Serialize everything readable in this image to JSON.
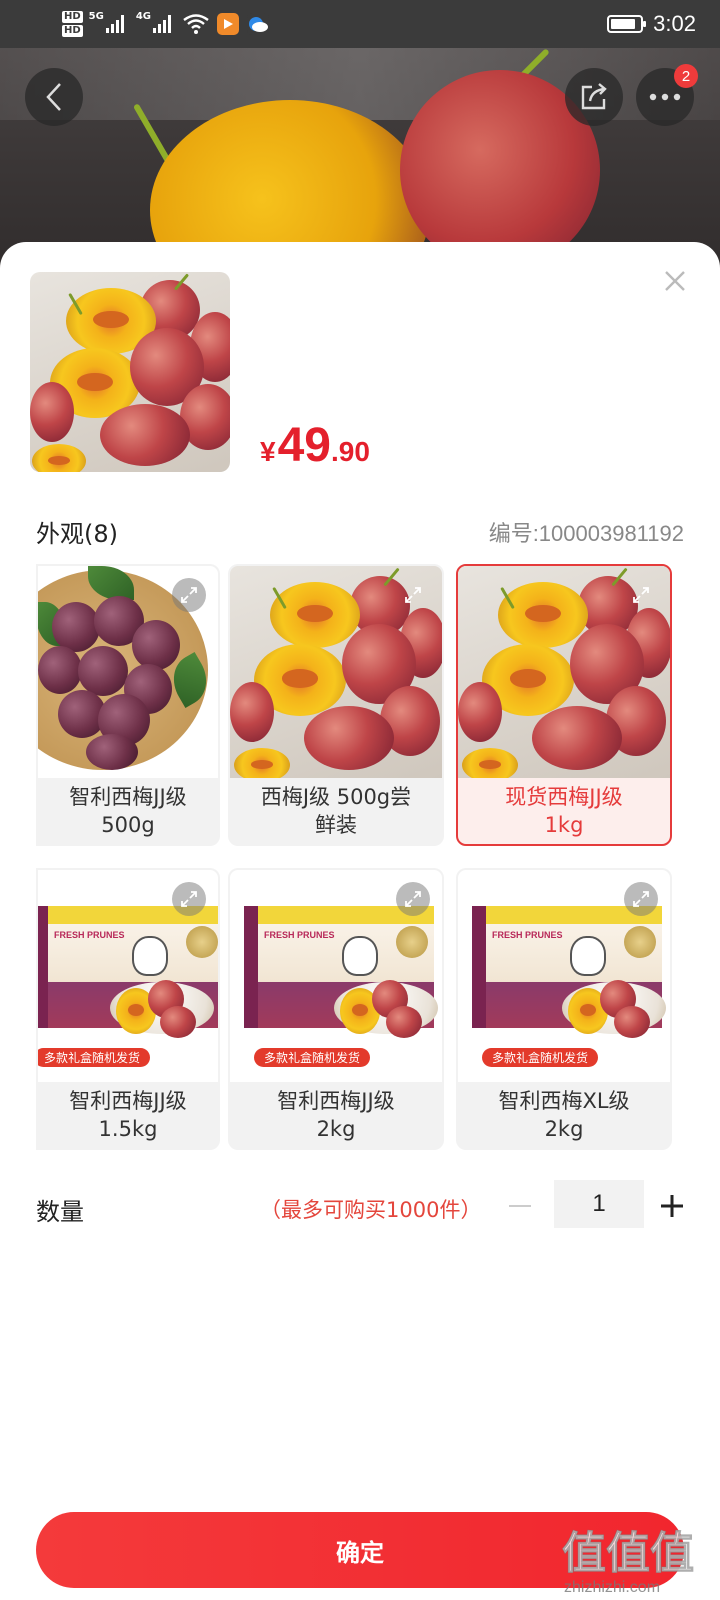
{
  "status_bar": {
    "hd1": "HD",
    "hd2": "HD",
    "net1": "5G",
    "net2": "4G",
    "battery_level": 0.85,
    "time": "3:02"
  },
  "nav": {
    "more_badge": "2"
  },
  "sheet": {
    "price": {
      "currency": "¥",
      "integer": "49",
      "decimal": ".90"
    },
    "spec_title": "外观(8)",
    "product_code": "编号:100003981192",
    "options": [
      {
        "label": "智利西梅JJ级\n500g",
        "selected": false,
        "style": "bowl"
      },
      {
        "label": "西梅J级 500g尝\n鲜装",
        "selected": false,
        "style": "halves"
      },
      {
        "label": "现货西梅JJ级\n1kg",
        "selected": true,
        "style": "halves"
      },
      {
        "label": "智利西梅JJ级\n1.5kg",
        "selected": false,
        "style": "box"
      },
      {
        "label": "智利西梅JJ级\n2kg",
        "selected": false,
        "style": "box"
      },
      {
        "label": "智利西梅XL级\n2kg",
        "selected": false,
        "style": "box"
      }
    ],
    "box_title": "FRESH PRUNES",
    "box_promo": "多款礼盒随机发货",
    "quantity": {
      "label": "数量",
      "limit_text": "（最多可购买1000件）",
      "minus": "−",
      "value": "1",
      "plus": "+"
    },
    "confirm_label": "确定"
  },
  "watermark": {
    "text": "值值值",
    "url_text": "zhizhizhi.com"
  },
  "colors": {
    "accent": "#e4202c",
    "selected_border": "#e53b3b",
    "button": "#f1262e"
  }
}
